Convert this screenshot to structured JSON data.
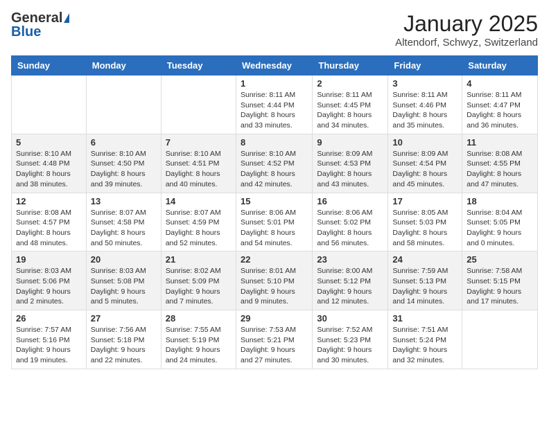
{
  "header": {
    "logo_general": "General",
    "logo_blue": "Blue",
    "month": "January 2025",
    "location": "Altendorf, Schwyz, Switzerland"
  },
  "weekdays": [
    "Sunday",
    "Monday",
    "Tuesday",
    "Wednesday",
    "Thursday",
    "Friday",
    "Saturday"
  ],
  "weeks": [
    [
      {
        "day": "",
        "info": ""
      },
      {
        "day": "",
        "info": ""
      },
      {
        "day": "",
        "info": ""
      },
      {
        "day": "1",
        "info": "Sunrise: 8:11 AM\nSunset: 4:44 PM\nDaylight: 8 hours\nand 33 minutes."
      },
      {
        "day": "2",
        "info": "Sunrise: 8:11 AM\nSunset: 4:45 PM\nDaylight: 8 hours\nand 34 minutes."
      },
      {
        "day": "3",
        "info": "Sunrise: 8:11 AM\nSunset: 4:46 PM\nDaylight: 8 hours\nand 35 minutes."
      },
      {
        "day": "4",
        "info": "Sunrise: 8:11 AM\nSunset: 4:47 PM\nDaylight: 8 hours\nand 36 minutes."
      }
    ],
    [
      {
        "day": "5",
        "info": "Sunrise: 8:10 AM\nSunset: 4:48 PM\nDaylight: 8 hours\nand 38 minutes."
      },
      {
        "day": "6",
        "info": "Sunrise: 8:10 AM\nSunset: 4:50 PM\nDaylight: 8 hours\nand 39 minutes."
      },
      {
        "day": "7",
        "info": "Sunrise: 8:10 AM\nSunset: 4:51 PM\nDaylight: 8 hours\nand 40 minutes."
      },
      {
        "day": "8",
        "info": "Sunrise: 8:10 AM\nSunset: 4:52 PM\nDaylight: 8 hours\nand 42 minutes."
      },
      {
        "day": "9",
        "info": "Sunrise: 8:09 AM\nSunset: 4:53 PM\nDaylight: 8 hours\nand 43 minutes."
      },
      {
        "day": "10",
        "info": "Sunrise: 8:09 AM\nSunset: 4:54 PM\nDaylight: 8 hours\nand 45 minutes."
      },
      {
        "day": "11",
        "info": "Sunrise: 8:08 AM\nSunset: 4:55 PM\nDaylight: 8 hours\nand 47 minutes."
      }
    ],
    [
      {
        "day": "12",
        "info": "Sunrise: 8:08 AM\nSunset: 4:57 PM\nDaylight: 8 hours\nand 48 minutes."
      },
      {
        "day": "13",
        "info": "Sunrise: 8:07 AM\nSunset: 4:58 PM\nDaylight: 8 hours\nand 50 minutes."
      },
      {
        "day": "14",
        "info": "Sunrise: 8:07 AM\nSunset: 4:59 PM\nDaylight: 8 hours\nand 52 minutes."
      },
      {
        "day": "15",
        "info": "Sunrise: 8:06 AM\nSunset: 5:01 PM\nDaylight: 8 hours\nand 54 minutes."
      },
      {
        "day": "16",
        "info": "Sunrise: 8:06 AM\nSunset: 5:02 PM\nDaylight: 8 hours\nand 56 minutes."
      },
      {
        "day": "17",
        "info": "Sunrise: 8:05 AM\nSunset: 5:03 PM\nDaylight: 8 hours\nand 58 minutes."
      },
      {
        "day": "18",
        "info": "Sunrise: 8:04 AM\nSunset: 5:05 PM\nDaylight: 9 hours\nand 0 minutes."
      }
    ],
    [
      {
        "day": "19",
        "info": "Sunrise: 8:03 AM\nSunset: 5:06 PM\nDaylight: 9 hours\nand 2 minutes."
      },
      {
        "day": "20",
        "info": "Sunrise: 8:03 AM\nSunset: 5:08 PM\nDaylight: 9 hours\nand 5 minutes."
      },
      {
        "day": "21",
        "info": "Sunrise: 8:02 AM\nSunset: 5:09 PM\nDaylight: 9 hours\nand 7 minutes."
      },
      {
        "day": "22",
        "info": "Sunrise: 8:01 AM\nSunset: 5:10 PM\nDaylight: 9 hours\nand 9 minutes."
      },
      {
        "day": "23",
        "info": "Sunrise: 8:00 AM\nSunset: 5:12 PM\nDaylight: 9 hours\nand 12 minutes."
      },
      {
        "day": "24",
        "info": "Sunrise: 7:59 AM\nSunset: 5:13 PM\nDaylight: 9 hours\nand 14 minutes."
      },
      {
        "day": "25",
        "info": "Sunrise: 7:58 AM\nSunset: 5:15 PM\nDaylight: 9 hours\nand 17 minutes."
      }
    ],
    [
      {
        "day": "26",
        "info": "Sunrise: 7:57 AM\nSunset: 5:16 PM\nDaylight: 9 hours\nand 19 minutes."
      },
      {
        "day": "27",
        "info": "Sunrise: 7:56 AM\nSunset: 5:18 PM\nDaylight: 9 hours\nand 22 minutes."
      },
      {
        "day": "28",
        "info": "Sunrise: 7:55 AM\nSunset: 5:19 PM\nDaylight: 9 hours\nand 24 minutes."
      },
      {
        "day": "29",
        "info": "Sunrise: 7:53 AM\nSunset: 5:21 PM\nDaylight: 9 hours\nand 27 minutes."
      },
      {
        "day": "30",
        "info": "Sunrise: 7:52 AM\nSunset: 5:23 PM\nDaylight: 9 hours\nand 30 minutes."
      },
      {
        "day": "31",
        "info": "Sunrise: 7:51 AM\nSunset: 5:24 PM\nDaylight: 9 hours\nand 32 minutes."
      },
      {
        "day": "",
        "info": ""
      }
    ]
  ]
}
